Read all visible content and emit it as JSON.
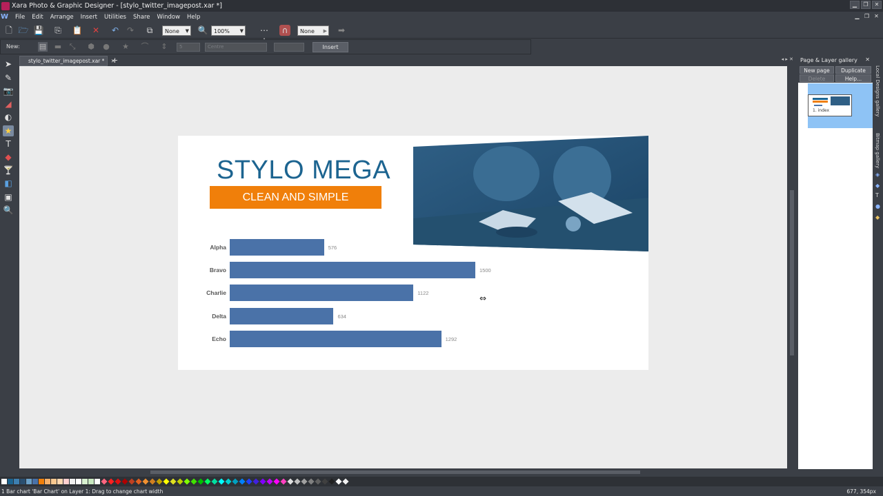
{
  "window": {
    "title": "Xara Photo & Graphic Designer - [stylo_twitter_imagepost.xar *]"
  },
  "menu": [
    "File",
    "Edit",
    "Arrange",
    "Insert",
    "Utilities",
    "Share",
    "Window",
    "Help"
  ],
  "toolbar": {
    "zoom_target": "None",
    "zoom_level": "100%",
    "snap": "None"
  },
  "toolbar2": {
    "new_label": "New:",
    "font": "Centre",
    "insert_label": "Insert"
  },
  "document": {
    "tab_name": "stylo_twitter_imagepost.xar *"
  },
  "design": {
    "title": "STYLO MEGA",
    "subtitle": "CLEAN AND SIMPLE",
    "accent_color": "#f07f0a",
    "title_color": "#1c6490",
    "bar_color": "#4a72a8"
  },
  "chart_data": {
    "type": "bar",
    "orientation": "horizontal",
    "categories": [
      "Alpha",
      "Bravo",
      "Charlie",
      "Delta",
      "Echo"
    ],
    "values": [
      576,
      1500,
      1122,
      634,
      1292
    ],
    "xlim": [
      0,
      1500
    ]
  },
  "gallery": {
    "title": "Page & Layer gallery",
    "new_page": "New page",
    "duplicate": "Duplicate",
    "delete": "Delete",
    "help": "Help...",
    "page_name": "1. index"
  },
  "side_tabs": {
    "local": "Local Designs gallery",
    "bitmap": "Bitmap gallery"
  },
  "status": {
    "message": "1 Bar chart 'Bar Chart' on Layer 1: Drag to change chart width",
    "coords": "677, 354px"
  }
}
